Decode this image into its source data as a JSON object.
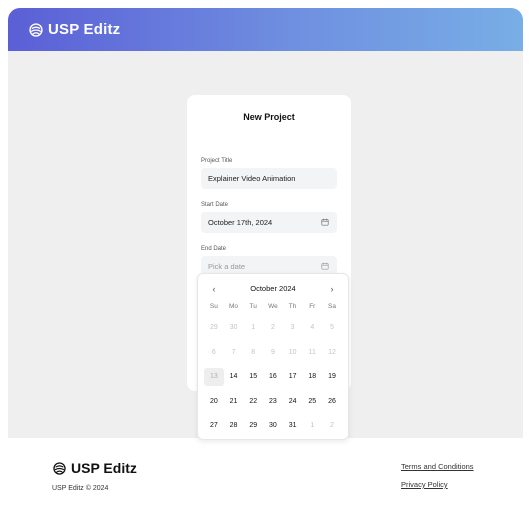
{
  "brand": {
    "name": "USP Editz"
  },
  "form": {
    "title": "New Project",
    "project_title": {
      "label": "Project Title",
      "value": "Explainer Video Animation"
    },
    "start_date": {
      "label": "Start Date",
      "value": "October 17th, 2024"
    },
    "end_date": {
      "label": "End Date",
      "placeholder": "Pick a date"
    }
  },
  "calendar": {
    "month": "October 2024",
    "prev": "‹",
    "next": "›",
    "weekdays": [
      "Su",
      "Mo",
      "Tu",
      "We",
      "Th",
      "Fr",
      "Sa"
    ],
    "weeks": [
      [
        "29",
        "30",
        "1",
        "2",
        "3",
        "4",
        "5"
      ],
      [
        "6",
        "7",
        "8",
        "9",
        "10",
        "11",
        "12"
      ],
      [
        "13",
        "14",
        "15",
        "16",
        "17",
        "18",
        "19"
      ],
      [
        "20",
        "21",
        "22",
        "23",
        "24",
        "25",
        "26"
      ],
      [
        "27",
        "28",
        "29",
        "30",
        "31",
        "1",
        "2"
      ]
    ]
  },
  "footer": {
    "brand": "USP Editz",
    "copyright": "USP Editz © 2024",
    "links": {
      "terms": "Terms and Conditions",
      "privacy": "Privacy Policy"
    }
  },
  "colors": {
    "header_start": "#5b5fd6",
    "header_end": "#78aee6"
  }
}
